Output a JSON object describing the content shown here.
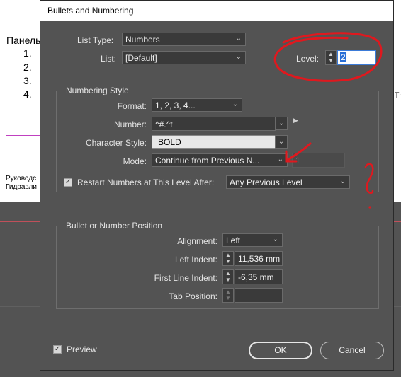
{
  "background_doc": {
    "heading": "Панель",
    "list_numbers": [
      "1.",
      "2.",
      "3.",
      "4."
    ],
    "right_fragment": "т-",
    "footer_line1": "Руководс",
    "footer_line2": "Гидравли"
  },
  "dialog": {
    "title": "Bullets and Numbering",
    "list_type_label": "List Type:",
    "list_type_value": "Numbers",
    "list_label": "List:",
    "list_value": "[Default]",
    "level_label": "Level:",
    "level_value": "2",
    "numbering_style": {
      "group_title": "Numbering Style",
      "format_label": "Format:",
      "format_value": "1, 2, 3, 4...",
      "number_label": "Number:",
      "number_value": "^#.^t",
      "char_style_label": "Character Style:",
      "char_style_value": "BOLD",
      "mode_label": "Mode:",
      "mode_value": "Continue from Previous N...",
      "mode_start_value": "1",
      "restart_label": "Restart Numbers at This Level After:",
      "restart_checked": true,
      "restart_value": "Any Previous Level"
    },
    "position": {
      "group_title": "Bullet or Number Position",
      "alignment_label": "Alignment:",
      "alignment_value": "Left",
      "left_indent_label": "Left Indent:",
      "left_indent_value": "11,536 mm",
      "first_line_label": "First Line Indent:",
      "first_line_value": "-6,35 mm",
      "tab_position_label": "Tab Position:",
      "tab_position_value": ""
    },
    "preview_label": "Preview",
    "preview_checked": true,
    "ok_label": "OK",
    "cancel_label": "Cancel"
  },
  "colors": {
    "dialog_bg": "#535353",
    "annotation_red": "#e0181e",
    "accent_blue": "#2a6fd6"
  }
}
